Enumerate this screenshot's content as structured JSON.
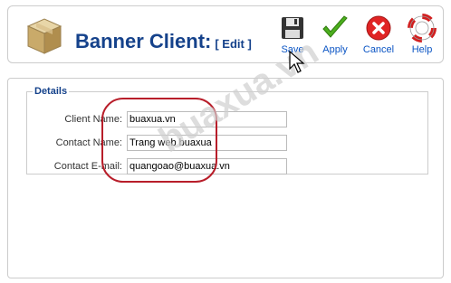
{
  "header": {
    "title": "Banner Client:",
    "subtitle": "[ Edit ]",
    "icon": "box-icon"
  },
  "toolbar": {
    "save_label": "Save",
    "apply_label": "Apply",
    "cancel_label": "Cancel",
    "help_label": "Help"
  },
  "details": {
    "legend": "Details",
    "fields": [
      {
        "label": "Client Name:",
        "value": "buaxua.vn"
      },
      {
        "label": "Contact Name:",
        "value": "Trang web buaxua"
      },
      {
        "label": "Contact E-mail:",
        "value": "quangoao@buaxua.vn"
      }
    ]
  },
  "watermark": "buaxua.vn",
  "colors": {
    "title": "#15428b",
    "link": "#0b55c4",
    "highlight": "#b81e2a",
    "border": "#cccccc"
  }
}
